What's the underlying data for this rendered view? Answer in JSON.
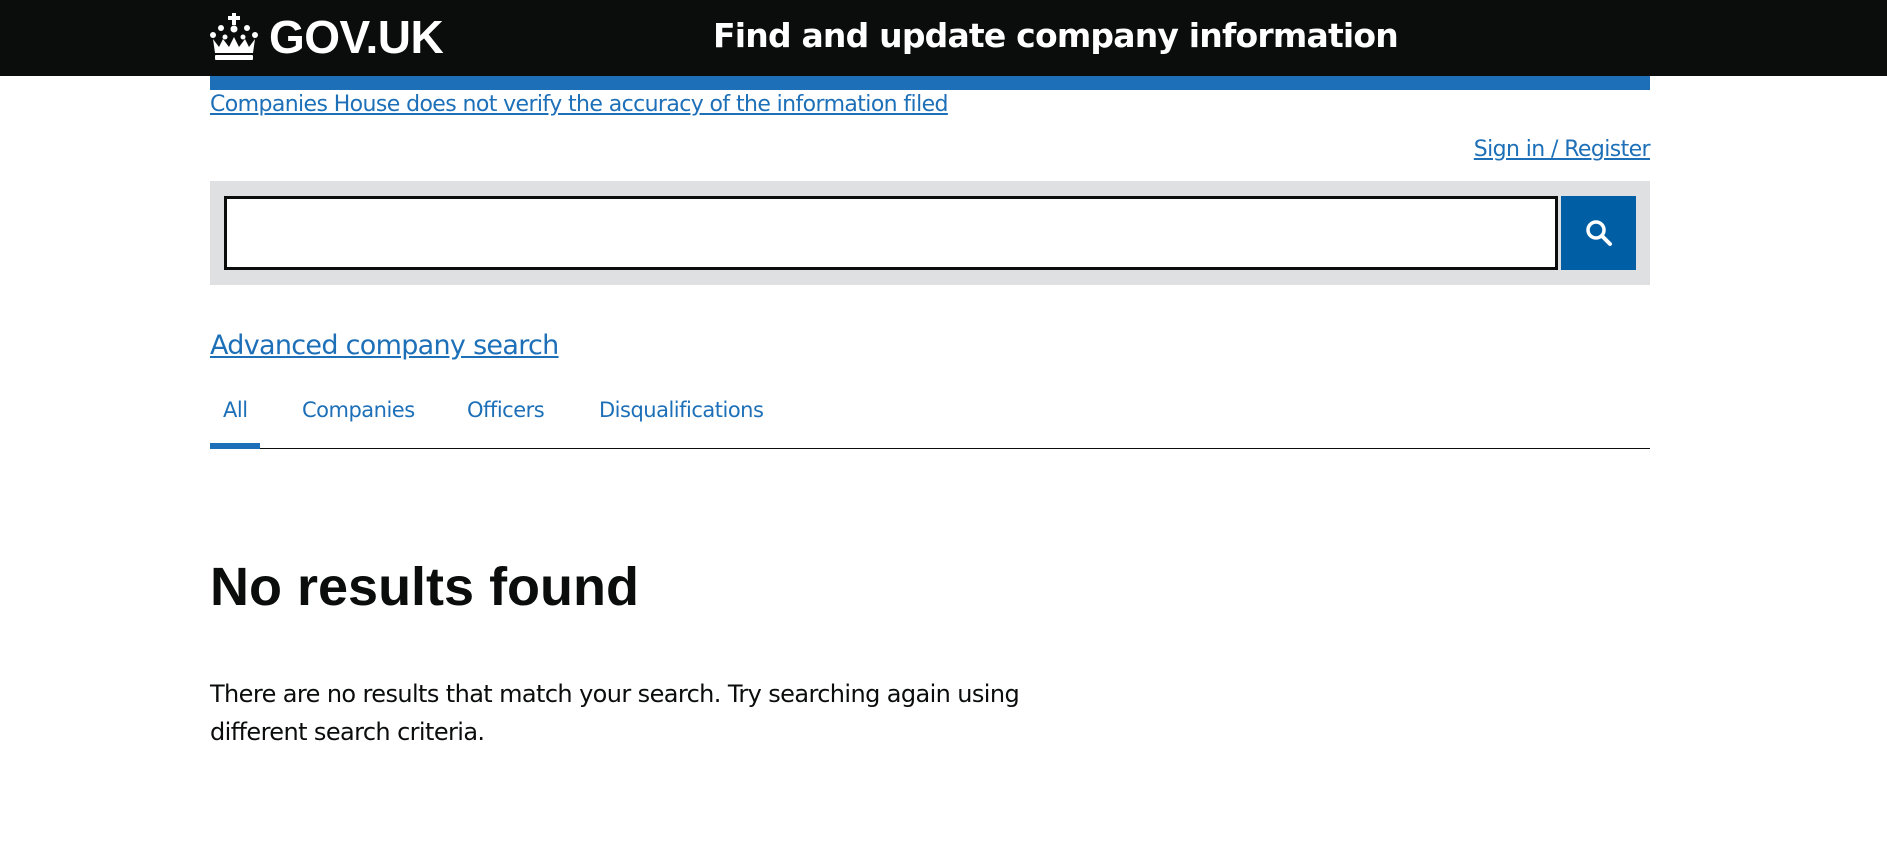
{
  "header": {
    "logo_text": "GOV.UK",
    "service_name": "Find and update company information",
    "crown_icon": "crown-icon"
  },
  "banner": {
    "disclaimer": "Companies House does not verify the accuracy of the information filed"
  },
  "account": {
    "signin_label": "Sign in / Register"
  },
  "search": {
    "value": "",
    "placeholder": "",
    "button_icon": "search-icon"
  },
  "advanced_search_label": "Advanced company search",
  "tabs": [
    {
      "label": "All",
      "active": true
    },
    {
      "label": "Companies",
      "active": false
    },
    {
      "label": "Officers",
      "active": false
    },
    {
      "label": "Disqualifications",
      "active": false
    }
  ],
  "results": {
    "heading": "No results found",
    "message": "There are no results that match your search. Try searching again using different search criteria."
  },
  "colors": {
    "header_bg": "#0b0c0c",
    "link": "#1d70b8",
    "search_button": "#005ea5",
    "search_panel": "#dee0e2"
  }
}
